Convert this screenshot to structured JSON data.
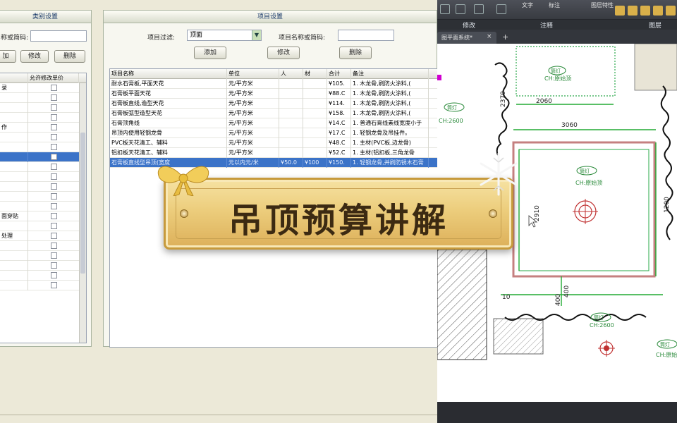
{
  "category_panel": {
    "title": "类别设置",
    "search_label": "称或简码:",
    "search_value": "",
    "buttons": {
      "add": "加",
      "modify": "修改",
      "delete": "删除"
    },
    "columns": {
      "name": "",
      "allow_edit": "允许修改单价"
    },
    "rows": [
      {
        "name": "录",
        "checked": false
      },
      {
        "name": "",
        "checked": false
      },
      {
        "name": "",
        "checked": false
      },
      {
        "name": "",
        "checked": false
      },
      {
        "name": "作",
        "checked": false
      },
      {
        "name": "",
        "checked": false
      },
      {
        "name": "",
        "checked": false
      },
      {
        "name": "",
        "checked": false,
        "selected": true
      },
      {
        "name": "",
        "checked": false
      },
      {
        "name": "",
        "checked": false
      },
      {
        "name": "",
        "checked": false
      },
      {
        "name": "",
        "checked": false
      },
      {
        "name": "",
        "checked": false
      },
      {
        "name": "面穿贴",
        "checked": false
      },
      {
        "name": "",
        "checked": false
      },
      {
        "name": "处理",
        "checked": false
      },
      {
        "name": "",
        "checked": false
      },
      {
        "name": "",
        "checked": false
      },
      {
        "name": "",
        "checked": false
      },
      {
        "name": "",
        "checked": false
      },
      {
        "name": "",
        "checked": false
      }
    ]
  },
  "item_panel": {
    "title": "项目设置",
    "filter_label": "项目过滤:",
    "filter_value": "顶面",
    "name_label": "项目名称或简码:",
    "name_value": "",
    "buttons": {
      "add": "添加",
      "modify": "修改",
      "delete": "删除"
    },
    "columns": [
      "项目名称",
      "单位",
      "人",
      "材",
      "合计",
      "备注"
    ],
    "rows": [
      [
        "耐水石膏板,平面天花",
        "元/平方米",
        "",
        "",
        "¥105.",
        "1. 木龙骨,刷防火涂料,("
      ],
      [
        "石膏板平面天花",
        "元/平方米",
        "",
        "",
        "¥88.C",
        "1. 木龙骨,刷防火涂料,("
      ],
      [
        "石膏板直线,造型天花",
        "元/平方米",
        "",
        "",
        "¥114.",
        "1. 木龙骨,刷防火涂料,("
      ],
      [
        "石膏板弧型造型天花",
        "元/平方米",
        "",
        "",
        "¥158.",
        "1. 木龙骨,刷防火涂料,("
      ],
      [
        "石膏顶角线",
        "元/平方米",
        "",
        "",
        "¥14.C",
        "1. 普通石膏线素线宽度小于"
      ],
      [
        "吊顶内使用轻钢龙骨",
        "元/平方米",
        "",
        "",
        "¥17.C",
        "1. 轻钢龙骨及吊挂件。"
      ],
      [
        "PVC板天花清工、辅料",
        "元/平方米",
        "",
        "",
        "¥48.C",
        "1. 主材(PVC板,边龙骨)"
      ],
      [
        "铝扣板天花清工、辅料",
        "元/平方米",
        "",
        "",
        "¥52.C",
        "1. 主材(铝扣板,三角龙骨"
      ],
      [
        "石膏板直线型吊顶(宽度",
        "元以内元/米",
        "¥50.0",
        "¥100",
        "¥150.",
        "1. 轻钢龙骨,并刷防锈木石膏"
      ]
    ],
    "selected_row": 8
  },
  "cad": {
    "ribbon_groups": [
      "修改",
      "注释",
      "图层"
    ],
    "ribbon_labels": [
      "文字",
      "标注",
      "图层特性"
    ],
    "doc_tab": "图平面系统*",
    "dims": [
      "2060",
      "3060",
      "2910",
      "400",
      "1200",
      "2370",
      "400",
      "10"
    ],
    "labels": [
      "CH:2600",
      "CH:原始顶",
      "CH:原始顶",
      "CH:2600",
      "CH:原始"
    ],
    "tags": [
      "筒灯",
      "筒灯",
      "筒灯",
      "筒灯",
      "筒灯"
    ]
  },
  "banner": {
    "text": "吊顶预算讲解"
  },
  "colors": {
    "selection": "#3b73c8",
    "banner_gold": "#eccd7c",
    "dim_green": "#22aa33"
  }
}
